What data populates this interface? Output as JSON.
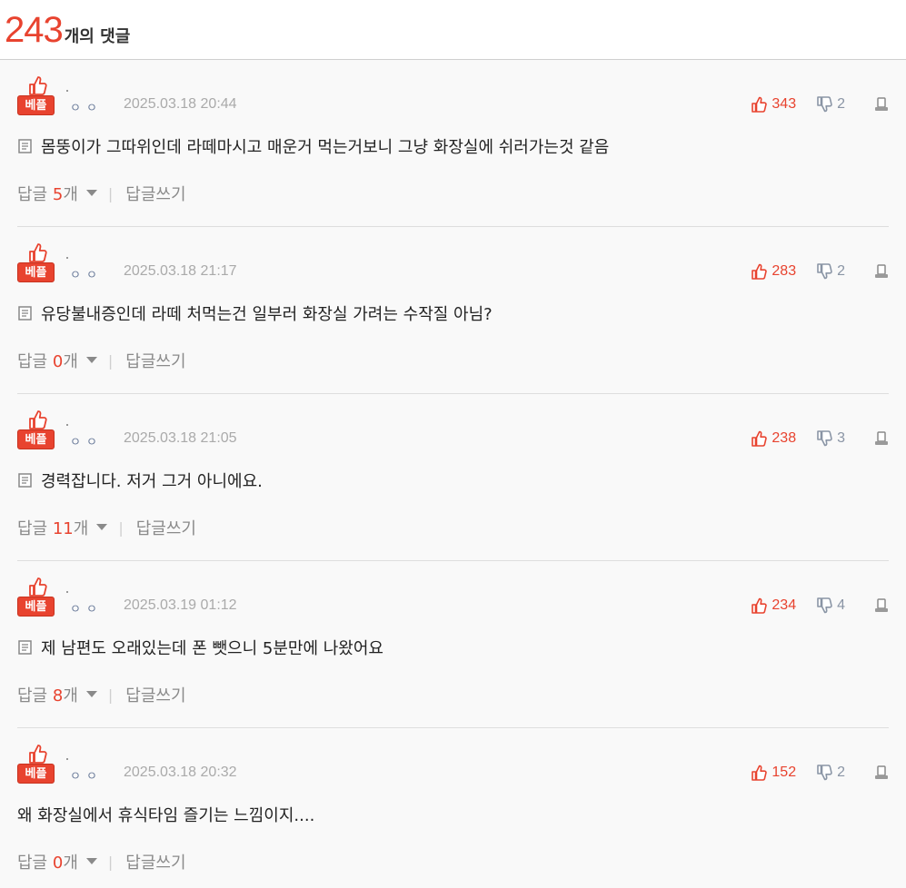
{
  "header": {
    "count": "243",
    "label": "개의 댓글"
  },
  "best_label": "베플",
  "reply_label": "답글",
  "reply_unit": "개",
  "write_reply_label": "답글쓰기",
  "comments": [
    {
      "author": "ㅇㅇ",
      "date": "2025.03.18 20:44",
      "likes": "343",
      "dislikes": "2",
      "text": "몸뚱이가 그따위인데 라떼마시고 매운거 먹는거보니 그냥 화장실에 쉬러가는것 같음",
      "replies": "5",
      "has_memo_icon": true
    },
    {
      "author": "ㅇㅇ",
      "date": "2025.03.18 21:17",
      "likes": "283",
      "dislikes": "2",
      "text": "유당불내증인데 라떼 처먹는건 일부러 화장실 가려는 수작질 아님?",
      "replies": "0",
      "has_memo_icon": true
    },
    {
      "author": "ㅇㅇ",
      "date": "2025.03.18 21:05",
      "likes": "238",
      "dislikes": "3",
      "text": "경력잡니다. 저거 그거 아니에요.",
      "replies": "11",
      "has_memo_icon": true
    },
    {
      "author": "ㅇㅇ",
      "date": "2025.03.19 01:12",
      "likes": "234",
      "dislikes": "4",
      "text": "제 남편도 오래있는데 폰 뺏으니 5분만에 나왔어요",
      "replies": "8",
      "has_memo_icon": true
    },
    {
      "author": "ㅇㅇ",
      "date": "2025.03.18 20:32",
      "likes": "152",
      "dislikes": "2",
      "text": "왜 화장실에서 휴식타임 즐기는 느낌이지....",
      "replies": "0",
      "has_memo_icon": false
    }
  ],
  "colors": {
    "accent": "#e8432f",
    "muted": "#8a95a5",
    "background": "#f9f9f9"
  }
}
